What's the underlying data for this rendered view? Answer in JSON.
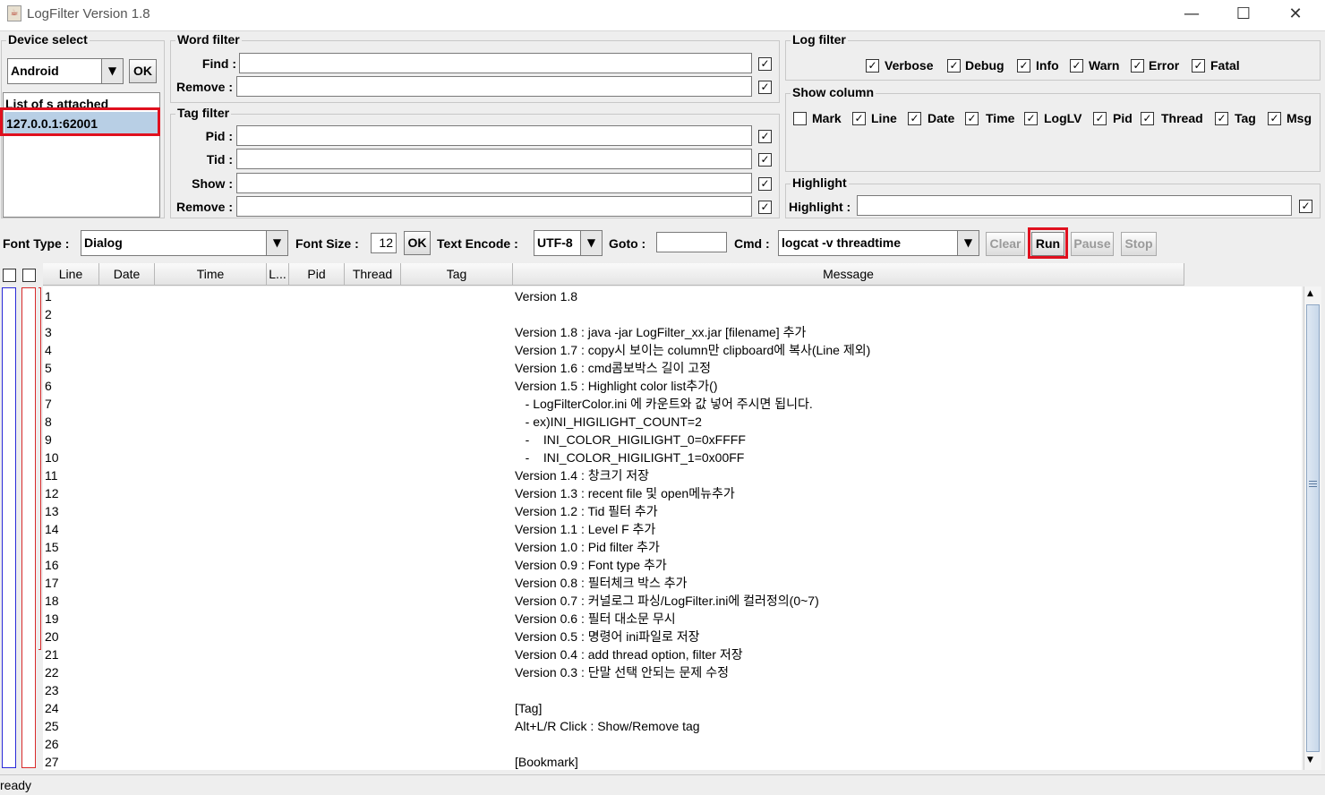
{
  "window": {
    "title": "LogFilter Version 1.8",
    "minimize": "—",
    "maximize": "☐",
    "close": "✕",
    "icon": "java-coffee-icon"
  },
  "device_select": {
    "title": "Device select",
    "type_value": "Android",
    "ok_label": "OK",
    "list_header": "List of s attached",
    "selected_device": "127.0.0.1:62001"
  },
  "word_filter": {
    "title": "Word filter",
    "find_label": "Find :",
    "remove_label": "Remove :",
    "find_value": "",
    "remove_value": "",
    "find_checked": "✓",
    "remove_checked": "✓"
  },
  "tag_filter": {
    "title": "Tag filter",
    "pid_label": "Pid :",
    "tid_label": "Tid :",
    "show_label": "Show :",
    "remove_label": "Remove :",
    "check": "✓"
  },
  "log_filter": {
    "title": "Log filter",
    "items": [
      "Verbose",
      "Debug",
      "Info",
      "Warn",
      "Error",
      "Fatal"
    ],
    "check": "✓"
  },
  "show_column": {
    "title": "Show column",
    "items": [
      "Mark",
      "Line",
      "Date",
      "Time",
      "LogLV",
      "Pid",
      "Thread",
      "Tag",
      "Msg"
    ],
    "check": "✓"
  },
  "highlight": {
    "title": "Highlight",
    "label": "Highlight :",
    "check": "✓"
  },
  "toolbar": {
    "font_type_label": "Font Type :",
    "font_type_value": "Dialog",
    "font_size_label": "Font Size :",
    "font_size_value": "12",
    "ok_label": "OK",
    "encode_label": "Text Encode :",
    "encode_value": "UTF-8",
    "goto_label": "Goto :",
    "goto_value": "",
    "cmd_label": "Cmd :",
    "cmd_value": "logcat -v threadtime",
    "clear_label": "Clear",
    "run_label": "Run",
    "pause_label": "Pause",
    "stop_label": "Stop"
  },
  "table": {
    "columns": [
      "Line",
      "Date",
      "Time",
      "L...",
      "Pid",
      "Thread",
      "Tag",
      "Message"
    ],
    "rows": [
      {
        "line": "1",
        "msg": "Version 1.8"
      },
      {
        "line": "2",
        "msg": ""
      },
      {
        "line": "3",
        "msg": "Version 1.8 : java -jar LogFilter_xx.jar [filename] 추가"
      },
      {
        "line": "4",
        "msg": "Version 1.7 : copy시 보이는 column만 clipboard에 복사(Line 제외)"
      },
      {
        "line": "5",
        "msg": "Version 1.6 : cmd콤보박스 길이 고정"
      },
      {
        "line": "6",
        "msg": "Version 1.5 : Highlight color list추가()"
      },
      {
        "line": "7",
        "msg": "   - LogFilterColor.ini 에 카운트와 값 넣어 주시면 됩니다."
      },
      {
        "line": "8",
        "msg": "   - ex)INI_HIGILIGHT_COUNT=2"
      },
      {
        "line": "9",
        "msg": "   -    INI_COLOR_HIGILIGHT_0=0xFFFF"
      },
      {
        "line": "10",
        "msg": "   -    INI_COLOR_HIGILIGHT_1=0x00FF"
      },
      {
        "line": "11",
        "msg": "Version 1.4 : 창크기 저장"
      },
      {
        "line": "12",
        "msg": "Version 1.3 : recent file 및 open메뉴추가"
      },
      {
        "line": "13",
        "msg": "Version 1.2 : Tid 필터 추가"
      },
      {
        "line": "14",
        "msg": "Version 1.1 : Level F 추가"
      },
      {
        "line": "15",
        "msg": "Version 1.0 : Pid filter 추가"
      },
      {
        "line": "16",
        "msg": "Version 0.9 : Font type 추가"
      },
      {
        "line": "17",
        "msg": "Version 0.8 : 필터체크 박스 추가"
      },
      {
        "line": "18",
        "msg": "Version 0.7 : 커널로그 파싱/LogFilter.ini에 컬러정의(0~7)"
      },
      {
        "line": "19",
        "msg": "Version 0.6 : 필터 대소문 무시"
      },
      {
        "line": "20",
        "msg": "Version 0.5 : 명령어 ini파일로 저장"
      },
      {
        "line": "21",
        "msg": "Version 0.4 : add thread option, filter 저장"
      },
      {
        "line": "22",
        "msg": "Version 0.3 : 단말 선택 안되는 문제 수정"
      },
      {
        "line": "23",
        "msg": ""
      },
      {
        "line": "24",
        "msg": "[Tag]"
      },
      {
        "line": "25",
        "msg": "Alt+L/R Click : Show/Remove tag"
      },
      {
        "line": "26",
        "msg": ""
      },
      {
        "line": "27",
        "msg": "[Bookmark]"
      }
    ]
  },
  "status": {
    "text": "ready"
  },
  "colors": {
    "highlight_box": "#e0101e",
    "selection": "#b8cfe5"
  }
}
